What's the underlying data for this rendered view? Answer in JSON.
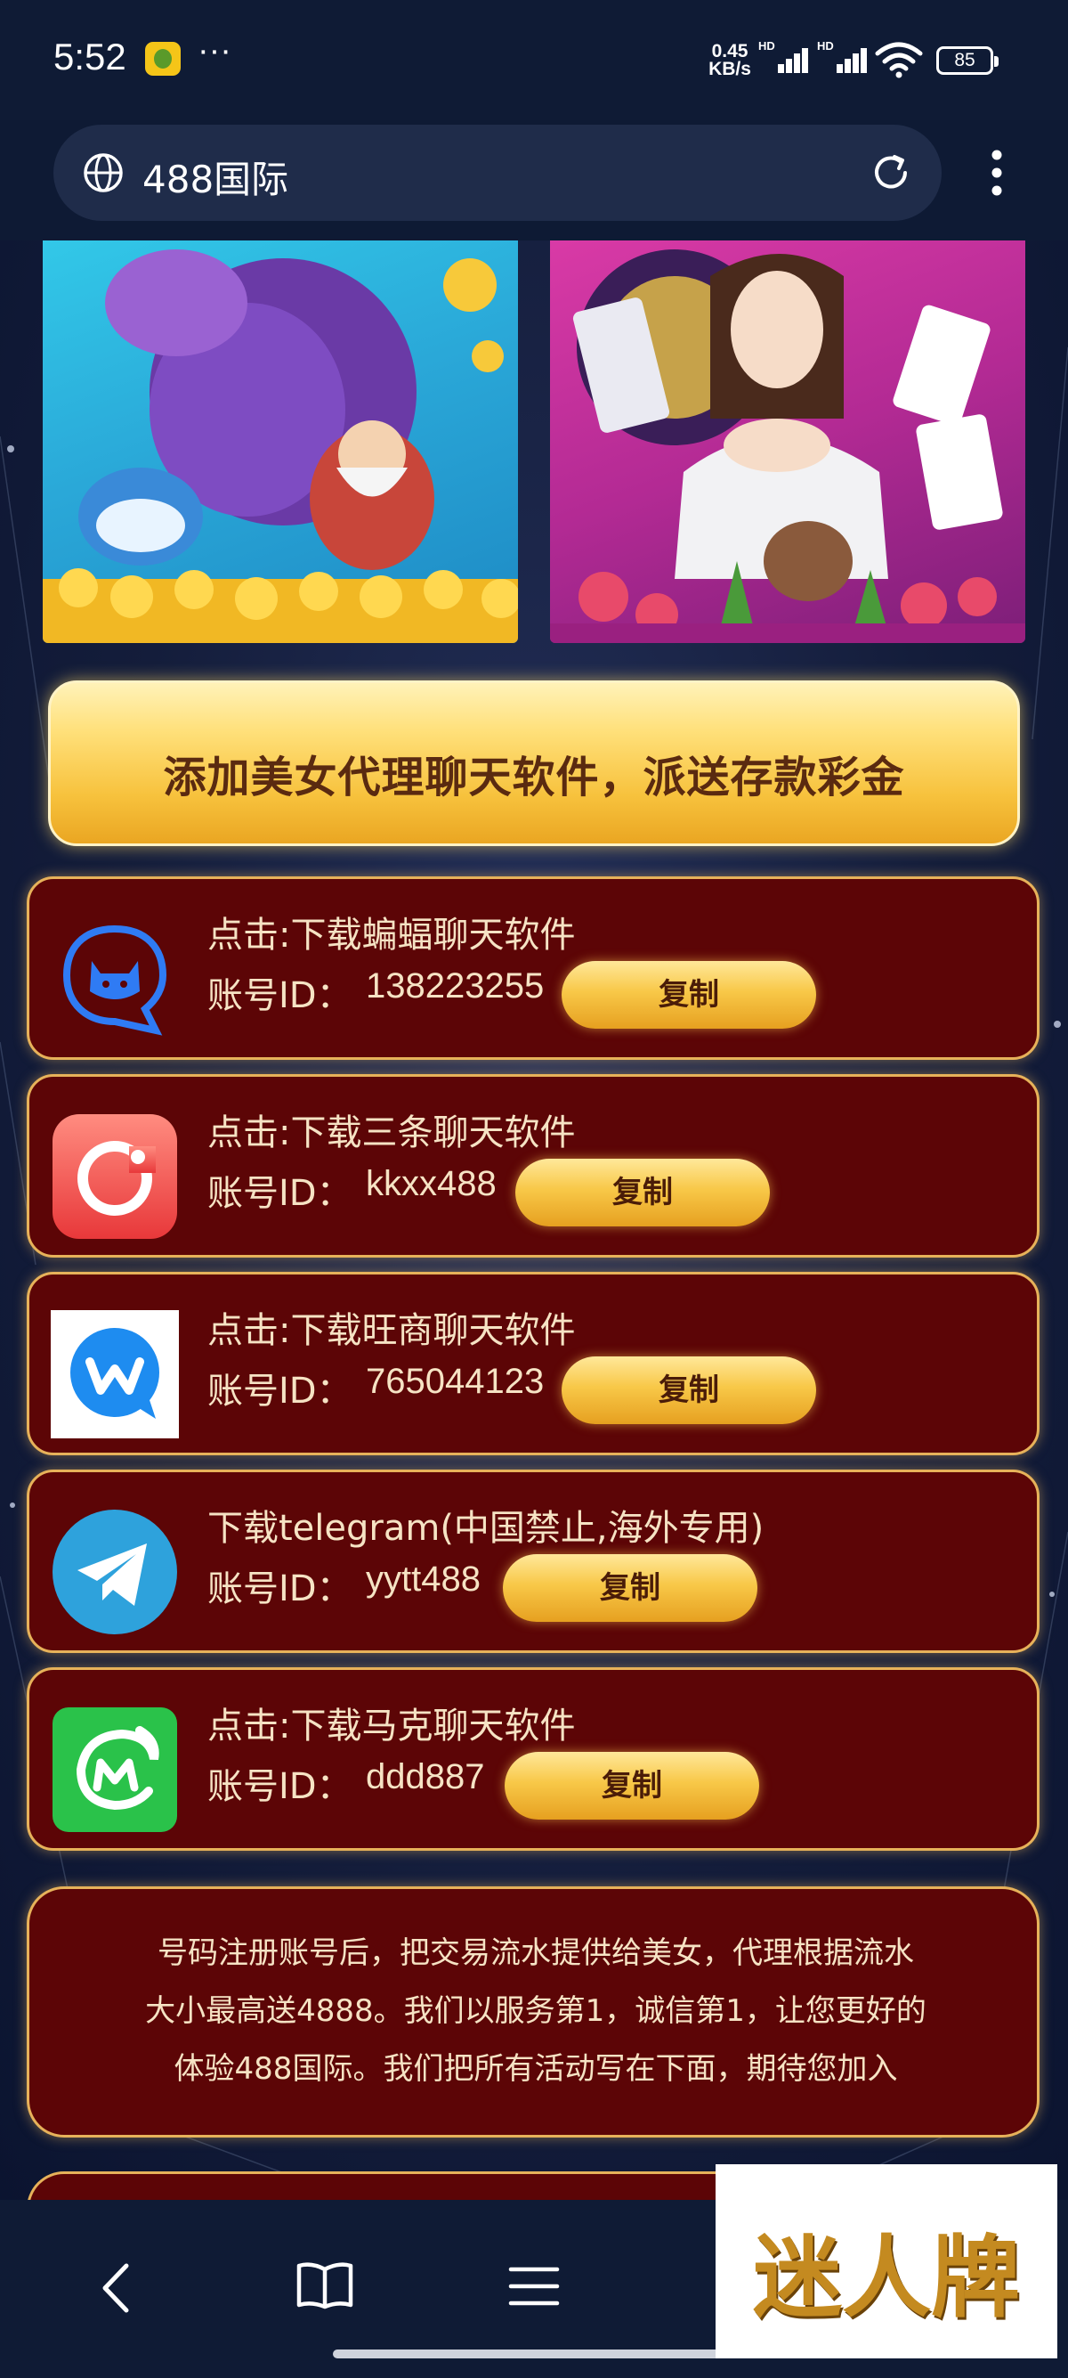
{
  "status_bar": {
    "time": "5:52",
    "dots": "···",
    "speed_value": "0.45",
    "speed_unit": "KB/s",
    "signal_1_label": "HD",
    "signal_2_label": "HD",
    "battery": "85"
  },
  "browser": {
    "address": "488国际"
  },
  "cta": {
    "label": "添加美女代理聊天软件，派送存款彩金"
  },
  "cards": [
    {
      "title": "点击:下载蝙蝠聊天软件",
      "account_label": "账号ID：",
      "account_id": "138223255",
      "copy_label": "复制",
      "icon": "bat-chat-icon"
    },
    {
      "title": "点击:下载三条聊天软件",
      "account_label": "账号ID：",
      "account_id": "kkxx488",
      "copy_label": "复制",
      "icon": "santiao-chat-icon"
    },
    {
      "title": "点击:下载旺商聊天软件",
      "account_label": "账号ID：",
      "account_id": "765044123",
      "copy_label": "复制",
      "icon": "wangshang-chat-icon"
    },
    {
      "title": "下载telegram(中国禁止,海外专用)",
      "account_label": "账号ID：",
      "account_id": "yytt488",
      "copy_label": "复制",
      "icon": "telegram-icon"
    },
    {
      "title": "点击:下载马克聊天软件",
      "account_label": "账号ID：",
      "account_id": "ddd887",
      "copy_label": "复制",
      "icon": "make-chat-icon"
    }
  ],
  "info": {
    "line1": "号码注册账号后，把交易流水提供给美女，代理根据流水",
    "line2": "大小最高送4888。我们以服务第1，诚信第1，让您更好的",
    "line3": "体验488国际。我们把所有活动写在下面，期待您加入"
  },
  "watermark": {
    "text": "迷人牌"
  },
  "colors": {
    "card_bg": "#5c0506",
    "card_border": "#e7b25a",
    "gold": "#f8c848",
    "page_bg": "#141d3b"
  }
}
